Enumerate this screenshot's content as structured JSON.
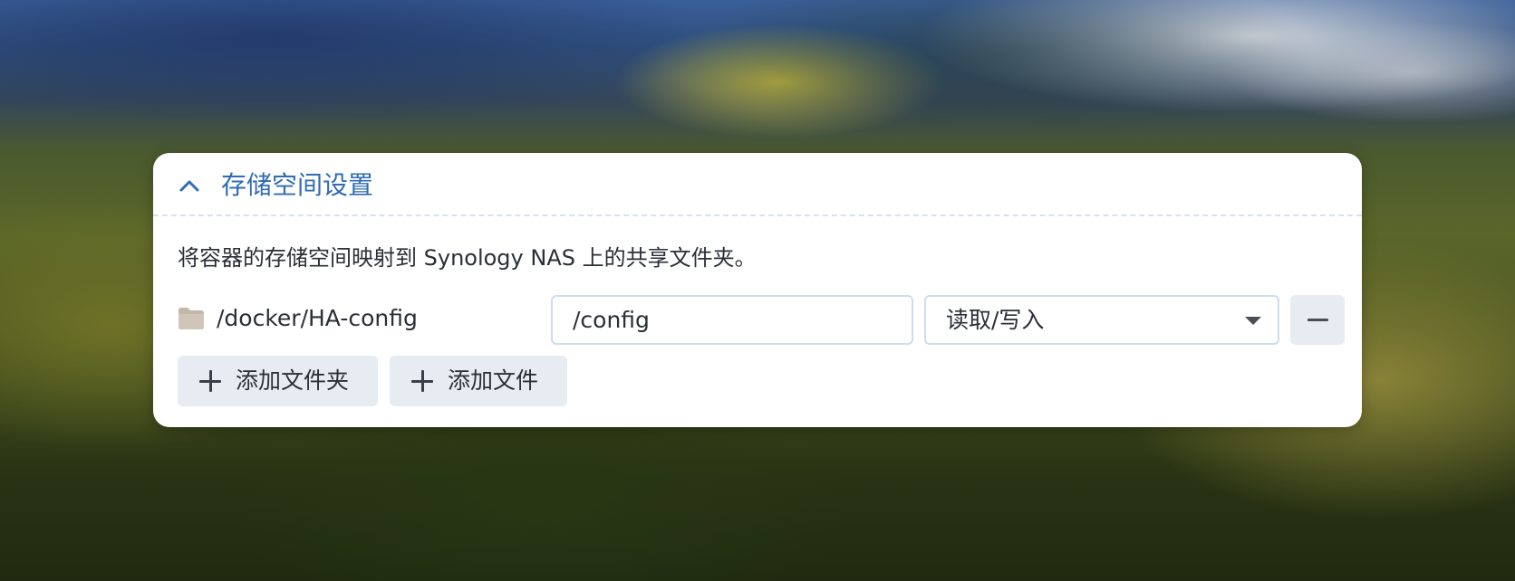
{
  "storage_panel": {
    "title": "存储空间设置",
    "description": "将容器的存储空间映射到 Synology NAS 上的共享文件夹。",
    "collapse_icon": "chevron-up-icon",
    "accent_color": "#2f6cb3",
    "mapping": {
      "host_path": "/docker/HA-config",
      "folder_icon": "folder-icon",
      "mount_path": "/config",
      "permission": "读取/写入",
      "remove_icon": "minus-icon"
    },
    "buttons": {
      "add_folder_label": "添加文件夹",
      "add_file_label": "添加文件",
      "add_icon": "plus-icon"
    }
  }
}
